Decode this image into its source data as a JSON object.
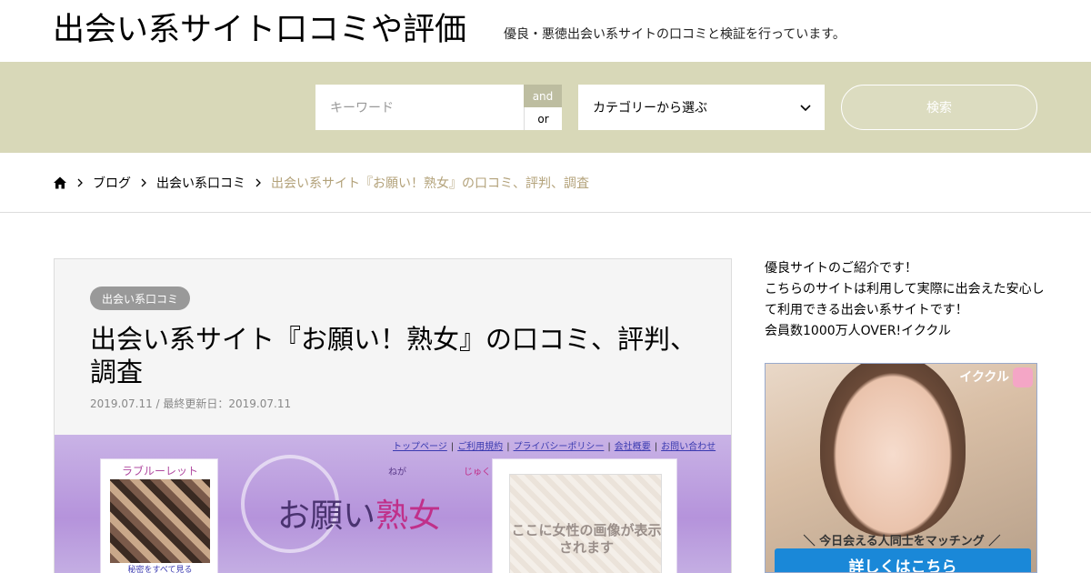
{
  "header": {
    "site_title": "出会い系サイト口コミや評価",
    "site_description": "優良・悪徳出会い系サイトの口コミと検証を行っています。"
  },
  "search": {
    "keyword_placeholder": "キーワード",
    "and_label": "and",
    "or_label": "or",
    "category_selected": "カテゴリーから選ぶ",
    "submit_label": "検索"
  },
  "breadcrumb": {
    "items": [
      "ブログ",
      "出会い系口コミ"
    ],
    "current": "出会い系サイト『お願い！熟女』の口コミ、評判、調査"
  },
  "article": {
    "category": "出会い系口コミ",
    "title": "出会い系サイト『お願い！熟女』の口コミ、評判、調査",
    "date": "2019.07.11 / 最終更新日：2019.07.11"
  },
  "banner": {
    "links": [
      "トップページ",
      "ご利用規約",
      "プライバシーポリシー",
      "会社概要",
      "お問い合わせ"
    ],
    "profile_title": "ラブルーレット",
    "profile_link": "秘密をすべて見る",
    "logo_ruby_1": "ねが",
    "logo_ruby_2": "じゅくじょ",
    "logo_main": "お願い",
    "logo_accent": "熟女",
    "placeholder_text": "ここに女性の画像が表示されます"
  },
  "sidebar": {
    "lines": [
      "優良サイトのご紹介です！",
      "こちらのサイトは利用して実際に出会えた安心して利用できる出会い系サイトです！",
      "会員数1000万人OVER!イククル"
    ],
    "ad": {
      "brand": "イククル",
      "tagline": "＼ 今日会える人同士をマッチング ／",
      "cta": "詳しくはこちら"
    }
  }
}
